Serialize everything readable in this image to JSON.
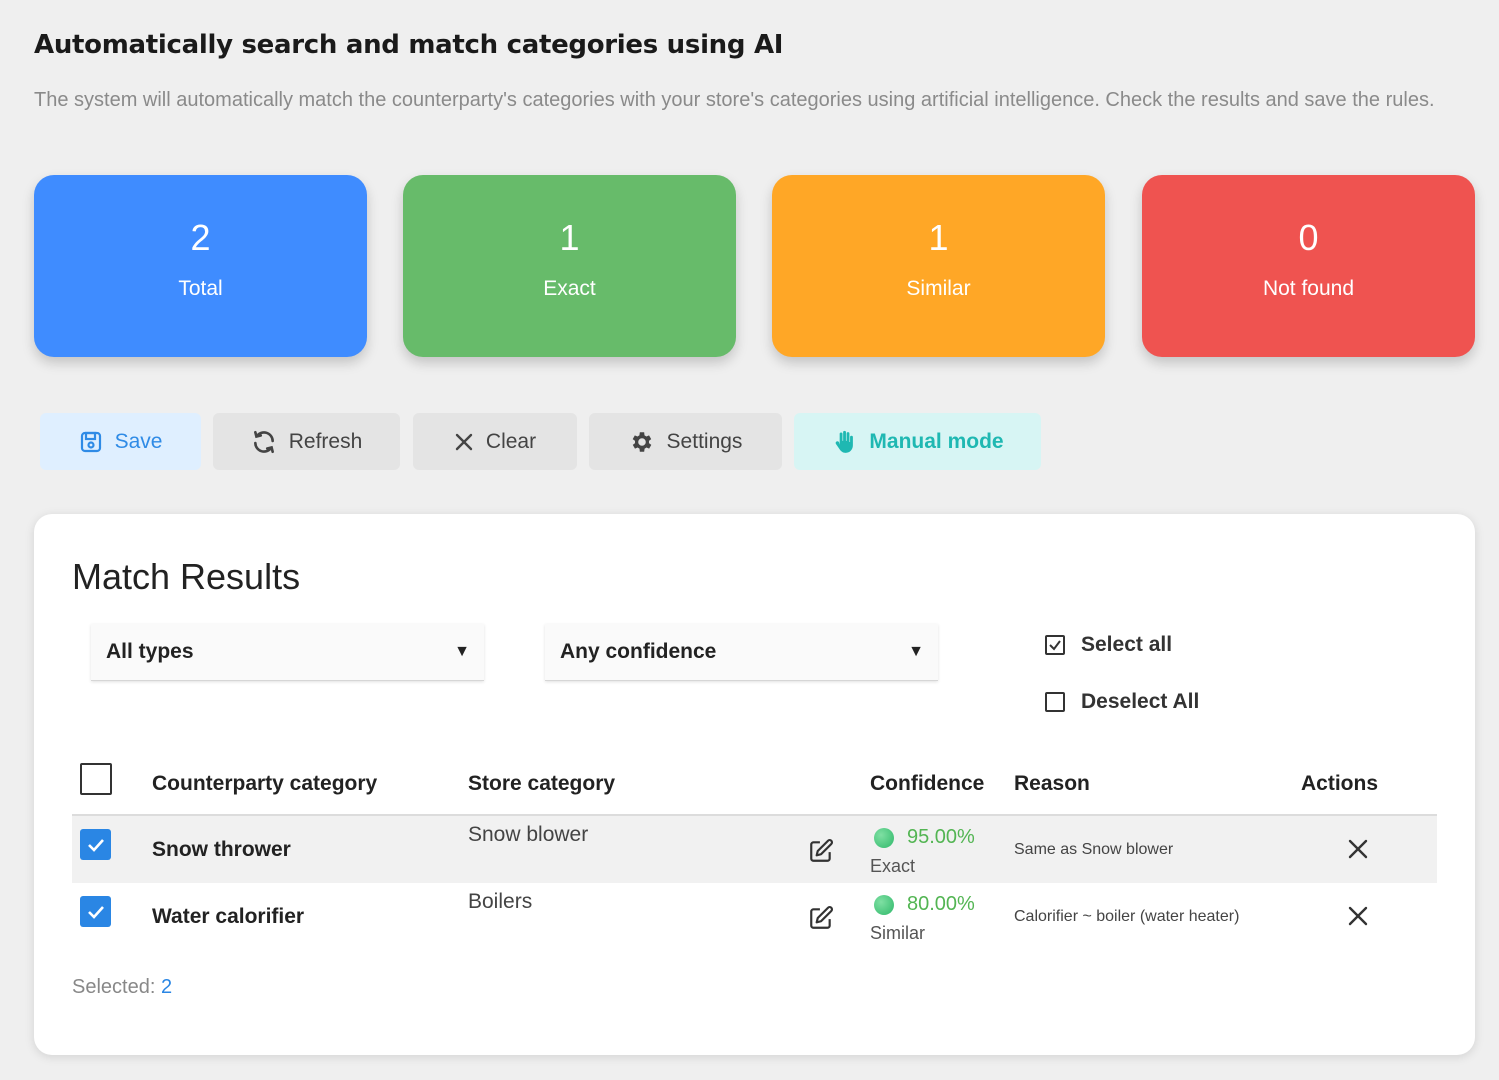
{
  "header": {
    "title": "Automatically search and match categories using AI",
    "description": "The system will automatically match the counterparty's categories with your store's categories using artificial intelligence. Check the results and save the rules."
  },
  "stats": [
    {
      "value": "2",
      "label": "Total",
      "color": "#3f8cff"
    },
    {
      "value": "1",
      "label": "Exact",
      "color": "#67bb6a"
    },
    {
      "value": "1",
      "label": "Similar",
      "color": "#ffa726"
    },
    {
      "value": "0",
      "label": "Not found",
      "color": "#ef5350"
    }
  ],
  "toolbar": {
    "save": "Save",
    "refresh": "Refresh",
    "clear": "Clear",
    "settings": "Settings",
    "manual": "Manual mode"
  },
  "panel": {
    "title": "Match Results",
    "type_filter": "All types",
    "confidence_filter": "Any confidence",
    "select_all": "Select all",
    "deselect_all": "Deselect All",
    "columns": {
      "counterparty": "Counterparty category",
      "store": "Store category",
      "confidence": "Confidence",
      "reason": "Reason",
      "actions": "Actions"
    },
    "rows": [
      {
        "checked": true,
        "counterparty": "Snow thrower",
        "store": "Snow blower",
        "confidence": "95.00%",
        "match_type": "Exact",
        "reason": "Same as Snow blower"
      },
      {
        "checked": true,
        "counterparty": "Water calorifier",
        "store": "Boilers",
        "confidence": "80.00%",
        "match_type": "Similar",
        "reason": "Calorifier ~ boiler (water heater)"
      }
    ],
    "selected_label": "Selected:",
    "selected_count": "2"
  },
  "icons": {
    "save": "floppy-disk-icon",
    "refresh": "refresh-icon",
    "clear": "close-icon",
    "settings": "gear-icon",
    "manual": "hand-icon",
    "edit": "pencil-edit-icon",
    "remove": "close-icon"
  }
}
